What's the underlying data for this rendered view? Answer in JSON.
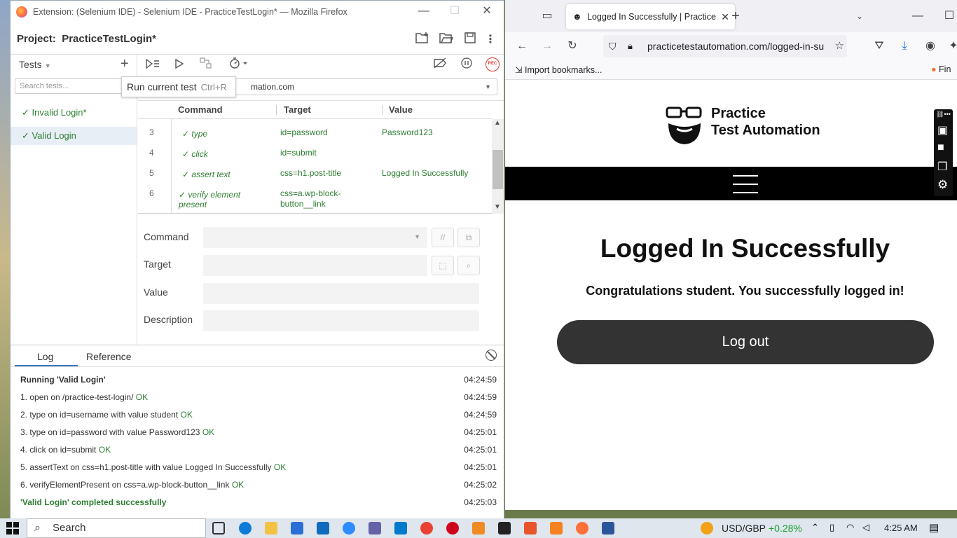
{
  "selenium": {
    "window_title": "Extension: (Selenium IDE) - Selenium IDE - PracticeTestLogin* — Mozilla Firefox",
    "project_label": "Project:",
    "project_name": "PracticeTestLogin*",
    "tests_header": "Tests",
    "search_placeholder": "Search tests...",
    "tests": [
      {
        "label": "Invalid Login*",
        "check": "✓"
      },
      {
        "label": "Valid Login",
        "check": "✓"
      }
    ],
    "tooltip": {
      "text": "Run current test",
      "shortcut": "Ctrl+R"
    },
    "base_url": "mation.com",
    "rec_label": "REC",
    "table": {
      "headers": [
        "Command",
        "Target",
        "Value"
      ],
      "rows": [
        {
          "num": "3",
          "command": "✓ type",
          "target": "id=password",
          "value": "Password123"
        },
        {
          "num": "4",
          "command": "✓ click",
          "target": "id=submit",
          "value": ""
        },
        {
          "num": "5",
          "command": "✓ assert text",
          "target": "css=h1.post-title",
          "value": "Logged In Successfully"
        },
        {
          "num": "6",
          "command": "✓ verify element present",
          "target": "css=a.wp-block-button__link",
          "value": ""
        }
      ]
    },
    "editor": {
      "command_label": "Command",
      "target_label": "Target",
      "value_label": "Value",
      "description_label": "Description",
      "comment_btn": "//"
    },
    "log": {
      "tabs": [
        "Log",
        "Reference"
      ],
      "lines": [
        {
          "text": "Running 'Valid Login'",
          "status": "",
          "time": "04:24:59",
          "kind": "header"
        },
        {
          "text": "1.   open on /practice-test-login/",
          "status": "OK",
          "time": "04:24:59",
          "kind": "step"
        },
        {
          "text": "2.   type on id=username with value student",
          "status": "OK",
          "time": "04:24:59",
          "kind": "step"
        },
        {
          "text": "3.   type on id=password with value Password123",
          "status": "OK",
          "time": "04:25:01",
          "kind": "step"
        },
        {
          "text": "4.   click on id=submit",
          "status": "OK",
          "time": "04:25:01",
          "kind": "step"
        },
        {
          "text": "5.   assertText on css=h1.post-title with value Logged In Successfully",
          "status": "OK",
          "time": "04:25:01",
          "kind": "step"
        },
        {
          "text": "6.   verifyElementPresent on css=a.wp-block-button__link",
          "status": "OK",
          "time": "04:25:02",
          "kind": "step"
        },
        {
          "text": "'Valid Login' completed successfully",
          "status": "",
          "time": "04:25:03",
          "kind": "success"
        }
      ]
    }
  },
  "firefox": {
    "tab_title": "Logged In Successfully | Practice",
    "url": "practicetestautomation.com/logged-in-su",
    "bookmark": "Import bookmarks...",
    "bookmark_right": "Fin",
    "site_name_line1": "Practice",
    "site_name_line2": "Test Automation",
    "page_title": "Logged In Successfully",
    "page_message": "Congratulations student. You successfully logged in!",
    "logout_label": "Log out"
  },
  "taskbar": {
    "search_label": "Search",
    "currency": "USD/GBP",
    "change": "+0.28%",
    "time": "4:25 AM"
  },
  "colors": {
    "success_green": "#2e7d32",
    "accent_blue": "#3b78c6",
    "rec_red": "#dd3333"
  }
}
